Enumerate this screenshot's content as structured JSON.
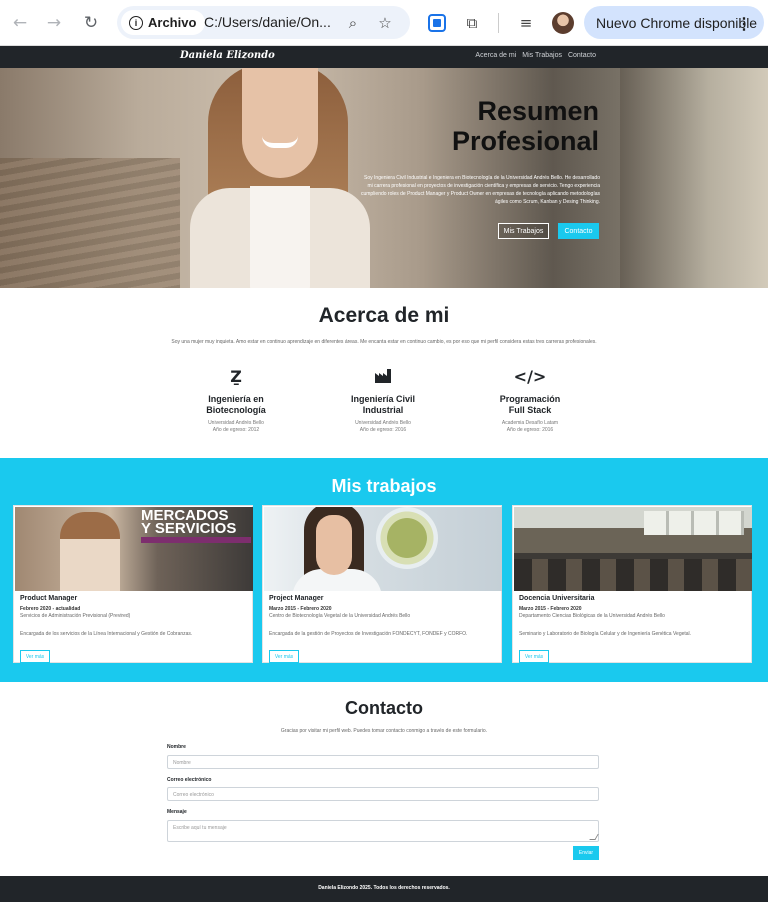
{
  "browser": {
    "back_icon": "arrow-left-icon",
    "forward_icon": "arrow-right-icon",
    "reload_icon": "reload-icon",
    "origin_label": "Archivo",
    "url": "C:/Users/danie/On...",
    "update_label": "Nuevo Chrome disponible"
  },
  "site_nav": {
    "brand": "Daniela Elizondo",
    "links": [
      "Acerca de mi",
      "Mis Trabajos",
      "Contacto"
    ]
  },
  "hero": {
    "title_line1": "Resumen",
    "title_line2": "Profesional",
    "description": "Soy Ingeniera Civil Industrial e Ingeniera en Biotecnología de la Universidad Andrés Bello. He desarrollado mi carrera profesional en proyectos de investigación científica y empresas de servicio. Tengo experiencia cumpliendo roles de Product Manager y Product Owner en empresas de tecnología aplicando metodologías ágiles como Scrum, Kanban y Desing Thinking.",
    "btn_works": "Mis Trabajos",
    "btn_contact": "Contacto"
  },
  "about": {
    "title": "Acerca de mi",
    "intro": "Soy una mujer muy inquieta. Amo estar en continuo aprendizaje en diferentes áreas. Me encanta estar en continuo cambio, es por eso que mi perfil considera estas tres carreras profesionales.",
    "skills": [
      {
        "icon": "dna-icon",
        "name": "Ingeniería en\nBiotecnología",
        "meta": "Universidad Andrés Bello\nAño de egreso: 2012"
      },
      {
        "icon": "industry-icon",
        "name": "Ingeniería Civil\nIndustrial",
        "meta": "Universidad Andrés Bello\nAño de egreso: 2016"
      },
      {
        "icon": "code-icon",
        "name": "Programación\nFull Stack",
        "meta": "Academia Desafío Latam\nAño de egreso: 2016"
      }
    ]
  },
  "works": {
    "title": "Mis trabajos",
    "cards": [
      {
        "image_text_1": "MERCADOS",
        "image_text_2": "Y SERVICIOS",
        "title": "Product Manager",
        "date": "Febrero 2020 - actualidad",
        "org": "Servicios de Administración Previsional (Previred)",
        "desc": "Encargada de los servicios de la Línea Internacional y Gestión de Cobranzas.",
        "btn": "Ver más"
      },
      {
        "title": "Project Manager",
        "date": "Marzo 2015 - Febrero 2020",
        "org": "Centro de Biotecnología Vegetal de la Universidad Andrés Bello",
        "desc": "Encargada de la gestión de Proyectos de Investigación FONDECYT, FONDEF y CORFO.",
        "btn": "Ver más"
      },
      {
        "title": "Docencia Universitaria",
        "date": "Marzo 2015 - Febrero 2020",
        "org": "Departamento Ciencias Biológicas de la Universidad Andrés Bello",
        "desc": "Seminario y Laboratorio de Biología Celular y de Ingeniería Genética Vegetal.",
        "btn": "Ver más"
      }
    ]
  },
  "contact": {
    "title": "Contacto",
    "intro": "Gracias por visitar mi perfil web. Puedes tomar contacto conmigo a través de este formulario.",
    "name_label": "Nombre",
    "name_placeholder": "Nombre",
    "email_label": "Correo electrónico",
    "email_placeholder": "Correo electrónico",
    "message_label": "Mensaje",
    "message_placeholder": "Escribe aquí tu mensaje",
    "submit": "Enviar"
  },
  "footer": {
    "text": "Daniela Elizondo 2025. Todos los derechos reservados."
  },
  "colors": {
    "accent": "#1ac9ee",
    "dark": "#212529",
    "chrome_update": "#d3e3fd"
  }
}
